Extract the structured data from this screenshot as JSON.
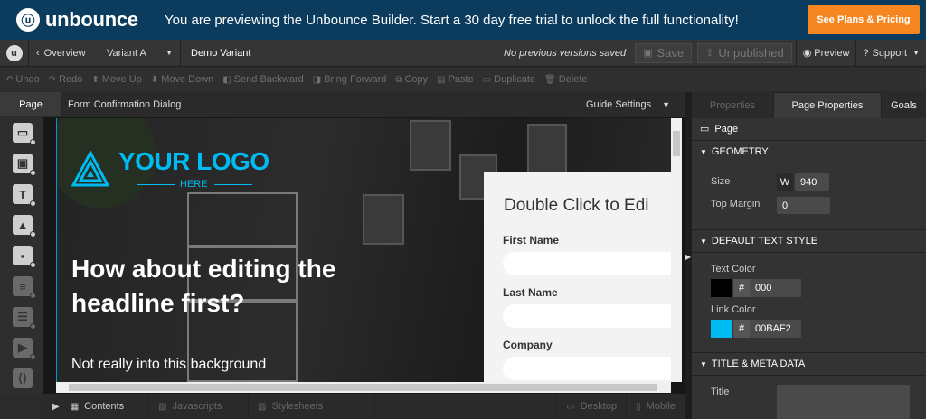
{
  "banner": {
    "brand": "unbounce",
    "message": "You are previewing the Unbounce Builder. Start a 30 day free trial to unlock the full functionality!",
    "cta": "See Plans & Pricing",
    "cta_color": "#f6861f"
  },
  "topbar": {
    "overview": "Overview",
    "variant": "Variant A",
    "title": "Demo Variant",
    "no_versions": "No previous versions saved",
    "save": "Save",
    "unpublished": "Unpublished",
    "preview": "Preview",
    "support": "Support"
  },
  "toolbar": {
    "undo": "Undo",
    "redo": "Redo",
    "move_up": "Move Up",
    "move_down": "Move Down",
    "send_backward": "Send Backward",
    "bring_forward": "Bring Forward",
    "copy": "Copy",
    "paste": "Paste",
    "duplicate": "Duplicate",
    "delete": "Delete"
  },
  "tabbar": {
    "page": "Page",
    "form": "Form Confirmation Dialog",
    "guide": "Guide Settings"
  },
  "canvas": {
    "logo": "YOUR LOGO",
    "logo_sub": "HERE",
    "headline": "How about editing the headline first?",
    "body": "Not really into this background",
    "accent": "#00baf2",
    "form": {
      "title": "Double Click to Edi",
      "fields": [
        "First Name",
        "Last Name",
        "Company"
      ]
    }
  },
  "bottombar": {
    "contents": "Contents",
    "javascripts": "Javascripts",
    "stylesheets": "Stylesheets",
    "desktop": "Desktop",
    "mobile": "Mobile"
  },
  "rightpanel": {
    "tabs": [
      "Properties",
      "Page Properties",
      "Goals"
    ],
    "page_label": "Page",
    "geometry": "GEOMETRY",
    "size_label": "Size",
    "size_w": "W",
    "size_value": "940",
    "top_margin_label": "Top Margin",
    "top_margin_value": "0",
    "default_text": "DEFAULT TEXT STYLE",
    "text_color_label": "Text Color",
    "text_color": "000",
    "text_color_swatch": "#000000",
    "link_color_label": "Link Color",
    "link_color": "00BAF2",
    "link_color_swatch": "#00baf2",
    "hash": "#",
    "meta": "TITLE & META DATA",
    "title_label": "Title"
  }
}
